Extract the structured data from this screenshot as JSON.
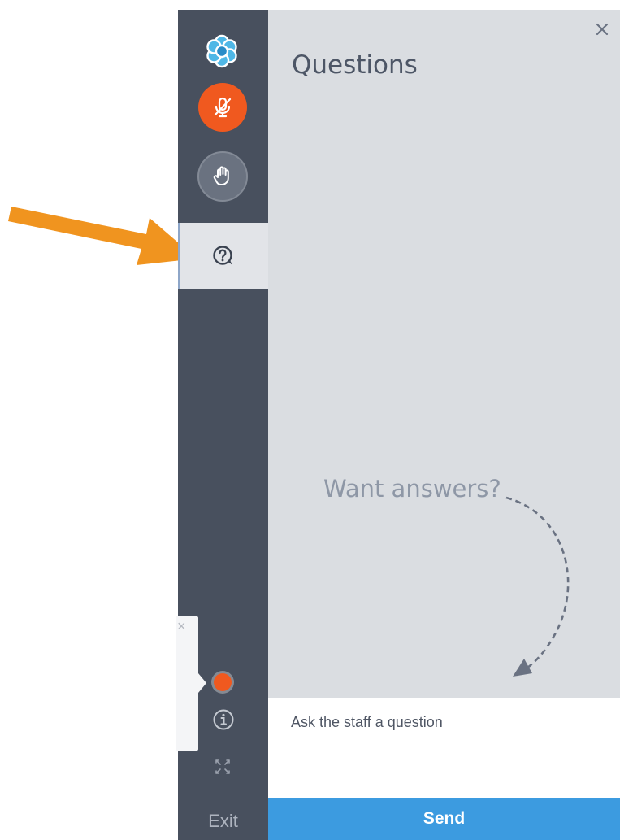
{
  "panel": {
    "title": "Questions",
    "empty_hint": "Want answers?",
    "input_placeholder": "Ask the staff a question",
    "send_label": "Send"
  },
  "rail": {
    "exit_label": "Exit",
    "icons": {
      "logo": "flower-logo-icon",
      "mic": "microphone-muted-icon",
      "hand": "raise-hand-icon",
      "questions": "question-bubble-icon",
      "info": "info-icon",
      "expand": "fullscreen-icon",
      "recording": "recording-dot-icon"
    }
  },
  "colors": {
    "rail_bg": "#48505e",
    "panel_bg": "#dadde1",
    "accent_orange": "#f0591f",
    "send_blue": "#3c9be0",
    "annotation_orange": "#f0941f"
  }
}
